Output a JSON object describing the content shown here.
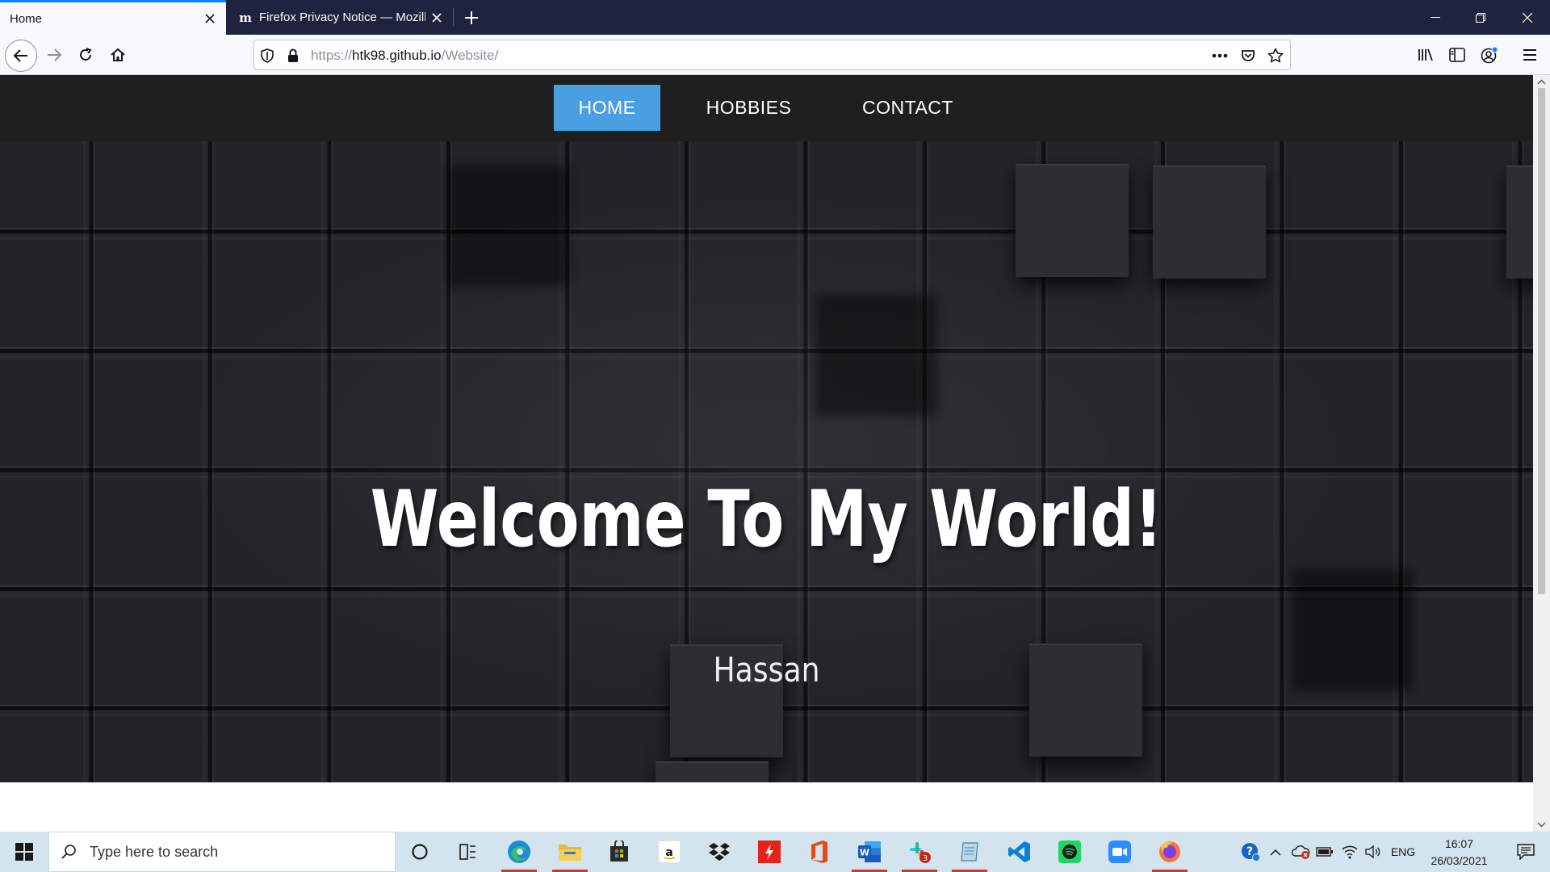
{
  "browser": {
    "tabs": [
      {
        "title": "Home",
        "active": true
      },
      {
        "title": "Firefox Privacy Notice — Mozilla",
        "active": false,
        "favicon": "m"
      }
    ],
    "url": {
      "scheme": "https://",
      "host": "htk98.github.io",
      "path": "/Website/"
    }
  },
  "site": {
    "nav": [
      {
        "label": "HOME",
        "active": true
      },
      {
        "label": "HOBBIES",
        "active": false
      },
      {
        "label": "CONTACT",
        "active": false
      }
    ],
    "hero": {
      "title": "Welcome To My World!",
      "subtitle": "Hassan"
    },
    "colors": {
      "nav_bg": "#1f1f1f",
      "nav_active": "#4a9fe0"
    }
  },
  "taskbar": {
    "search_placeholder": "Type here to search",
    "apps": [
      "cortana-circle",
      "task-view",
      "edge",
      "file-explorer",
      "microsoft-store",
      "amazon",
      "dropbox",
      "adobe-acrobat",
      "office",
      "word",
      "slack",
      "notepad",
      "vscode",
      "spotify",
      "zoom",
      "firefox"
    ],
    "slack_badge": "3",
    "language": "ENG",
    "time": "16:07",
    "date": "26/03/2021"
  }
}
